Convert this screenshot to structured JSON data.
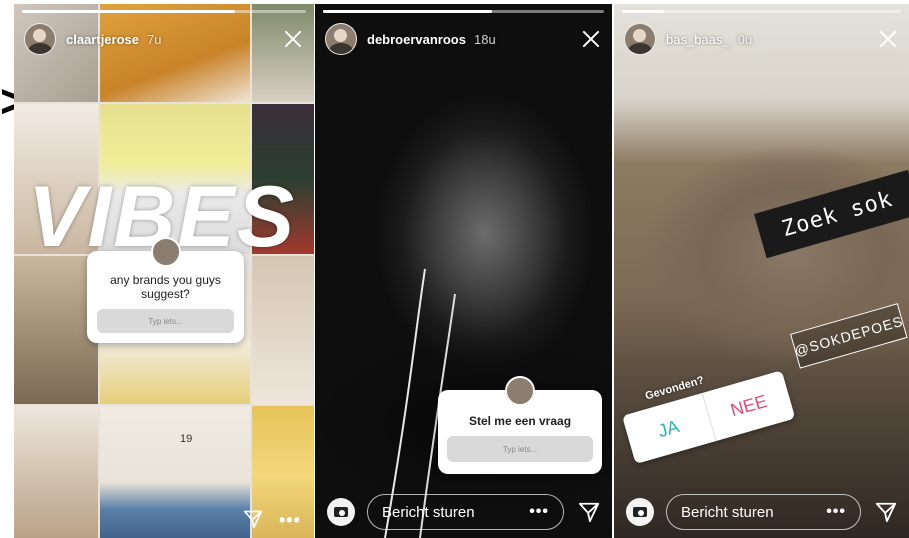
{
  "nav": {
    "prev_glyph": ">"
  },
  "stories": [
    {
      "username": "claartjerose",
      "time": "7u",
      "progress": 0.75,
      "sticker_text": "VIBES",
      "question": {
        "prompt": "any brands you guys suggest?",
        "placeholder": "Typ iets..."
      },
      "page_number": "19",
      "more": "•••"
    },
    {
      "username": "debroervanroos",
      "time": "18u",
      "progress": 0.6,
      "question": {
        "prompt": "Stel me een vraag",
        "placeholder": "Typ iets..."
      },
      "message_placeholder": "Bericht sturen",
      "more": "•••"
    },
    {
      "username": "bas_baas_",
      "time": "0u",
      "progress": 0.15,
      "sticker_title": "Zoek sok",
      "mention": "@SOKDEPOES",
      "poll": {
        "question": "Gevonden?",
        "option_yes": "JA",
        "option_no": "NEE"
      },
      "message_placeholder": "Bericht sturen",
      "more": "•••"
    }
  ],
  "colors": {
    "white": "#ffffff",
    "poll_yes": "#2bb3c0",
    "poll_no": "#e8487a"
  }
}
